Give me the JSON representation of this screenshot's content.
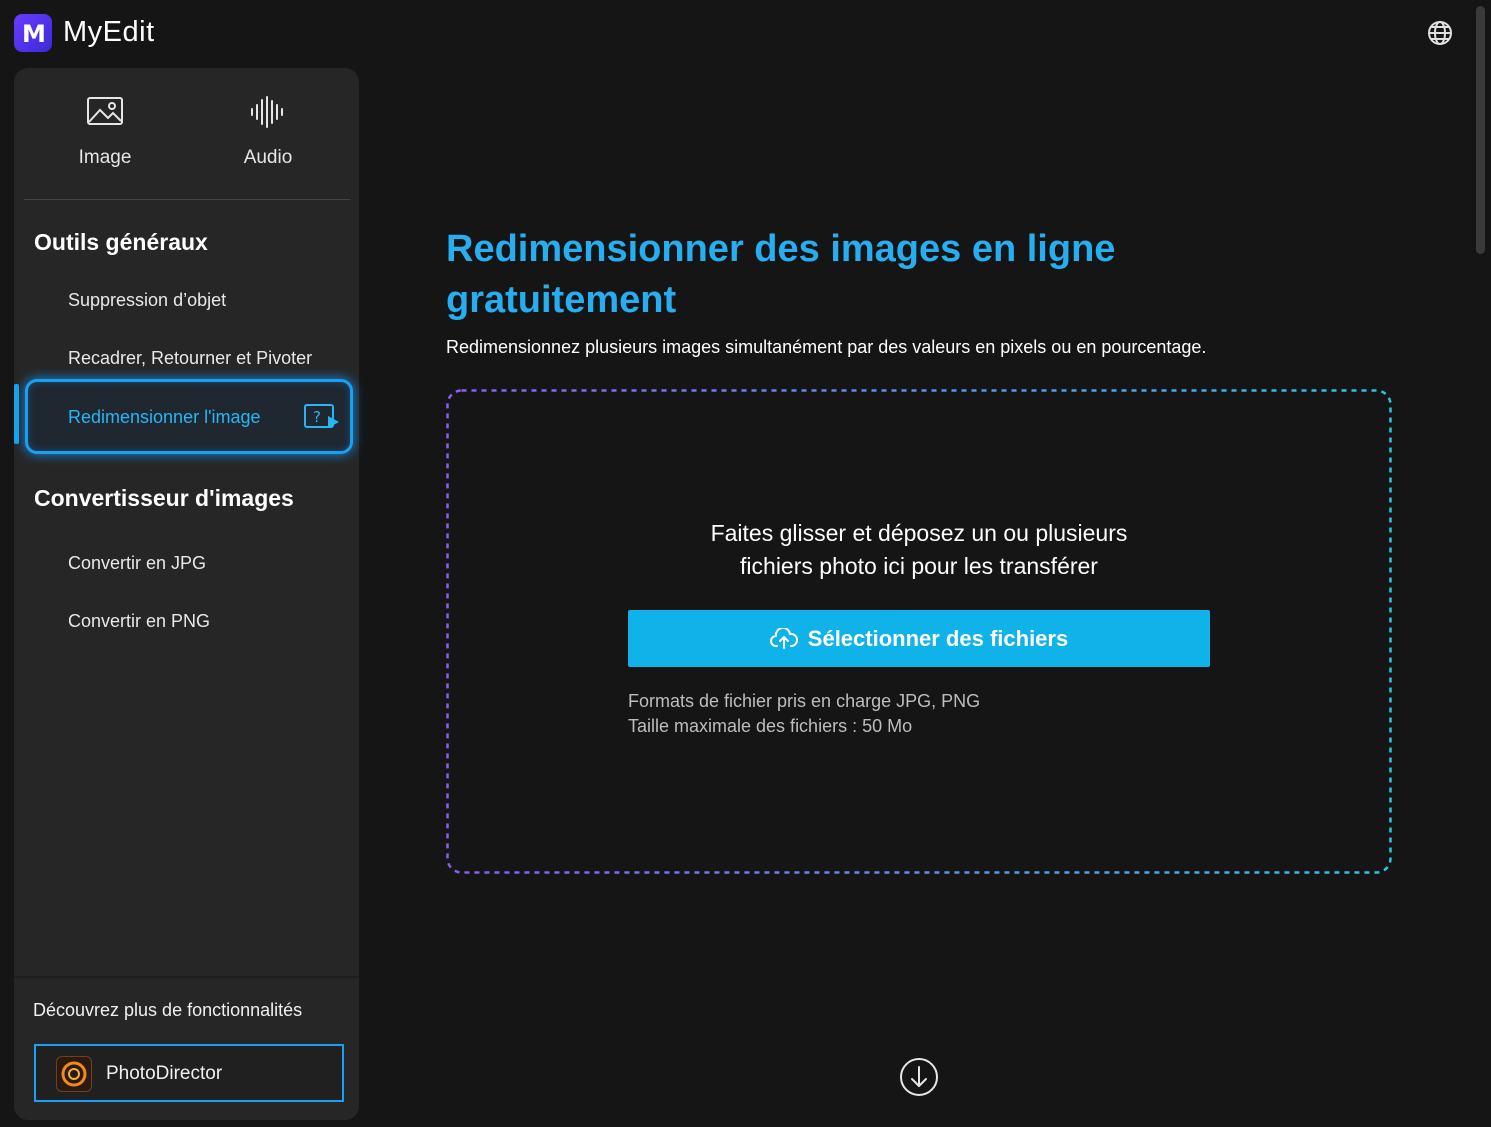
{
  "app": {
    "brand": "MyEdit",
    "logo_letter": "M",
    "icons": {
      "logo": "myedit-logo-icon",
      "language": "globe-icon",
      "image_mode": "image-icon",
      "audio_mode": "audio-waveform-icon",
      "help_video": "help-video-icon",
      "upload": "cloud-upload-icon",
      "scroll_down": "arrow-down-circle-icon",
      "photodirector": "photodirector-logo-icon"
    },
    "colors": {
      "accent": "#26aef0",
      "button": "#10b2ea",
      "sidebar_bg": "#262626",
      "page_bg": "#151515",
      "dash_start": "#8a5cf6",
      "dash_end": "#2ec4e8"
    }
  },
  "sidebar": {
    "modes": [
      {
        "label": "Image"
      },
      {
        "label": "Audio"
      }
    ],
    "sections": [
      {
        "title": "Outils généraux",
        "items": [
          {
            "label": "Suppression d’objet"
          },
          {
            "label": "Recadrer, Retourner et Pivoter"
          },
          {
            "label": "Redimensionner l'image",
            "active": true
          }
        ]
      },
      {
        "title": "Convertisseur d'images",
        "items": [
          {
            "label": "Convertir en JPG"
          },
          {
            "label": "Convertir en PNG"
          }
        ]
      }
    ],
    "discover": {
      "title": "Découvrez plus de fonctionnalités",
      "product": "PhotoDirector"
    }
  },
  "main": {
    "title": "Redimensionner des images en ligne gratuitement",
    "subtitle": "Redimensionnez plusieurs images simultanément par des valeurs en pixels ou en pourcentage.",
    "dropzone": {
      "line1": "Faites glisser et déposez un ou plusieurs",
      "line2": "fichiers photo ici pour les transférer",
      "button": "Sélectionner des fichiers",
      "formats": "Formats de fichier pris en charge JPG, PNG",
      "max_size": "Taille maximale des fichiers : 50 Mo"
    }
  }
}
